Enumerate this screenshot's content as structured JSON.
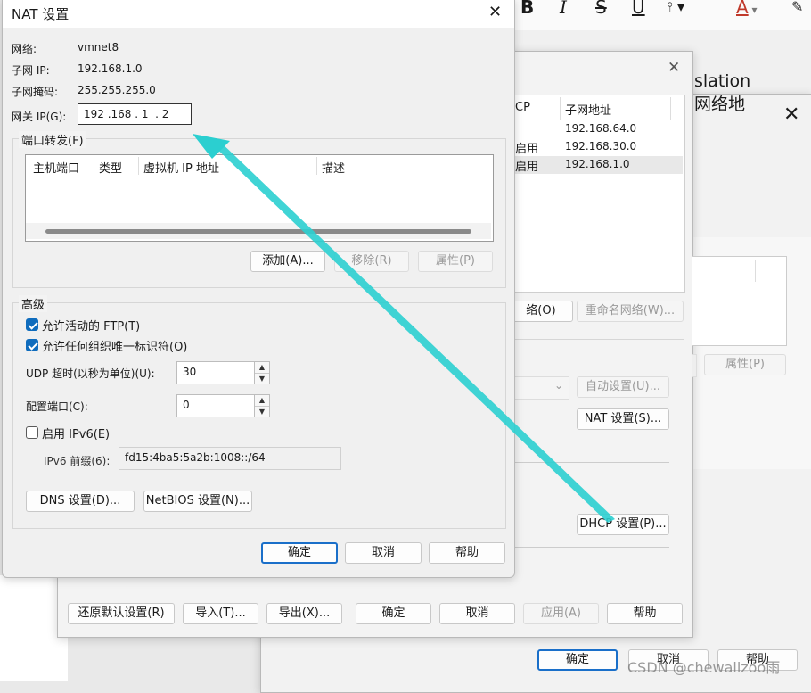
{
  "colors": {
    "accent": "#1a6fc9",
    "arrow": "#2bcfd0",
    "checked": "#0f6cbd"
  },
  "editor_toolbar": {
    "icons": [
      "bold-icon",
      "italic-icon",
      "strikethrough-icon",
      "underline-icon",
      "text-style-icon",
      "font-color-icon",
      "highlight-icon"
    ],
    "bold": "B",
    "italic": "I",
    "strike": "S",
    "underline": "U",
    "color": "A"
  },
  "bg_window": {
    "title_fragment": "slation 网络地",
    "table_headers": [
      "CP",
      "子网地址"
    ],
    "rows": [
      {
        "dhcp": "",
        "subnet": "192.168.64.0"
      },
      {
        "dhcp": "启用",
        "subnet": "192.168.30.0"
      },
      {
        "dhcp": "启用",
        "subnet": "192.168.1.0"
      }
    ],
    "network_btn": "络(O)",
    "rename_btn": "重命名网络(W)...",
    "properties_btn": "属性(P)",
    "auto_btn": "自动设置(U)...",
    "nat_btn": "NAT 设置(S)...",
    "dhcp_btn": "DHCP 设置(P)...",
    "restore_btn": "还原默认设置(R)",
    "import_btn": "导入(T)...",
    "export_btn": "导出(X)...",
    "ok_btn": "确定",
    "cancel_btn": "取消",
    "apply_btn": "应用(A)",
    "help_btn": "帮助",
    "far_ok": "确定",
    "far_cancel": "取消",
    "far_help": "帮助"
  },
  "watermark": "CSDN @chewallzoo雨",
  "nat": {
    "title": "NAT 设置",
    "network_label": "网络:",
    "network_value": "vmnet8",
    "subnet_ip_label": "子网 IP:",
    "subnet_ip_value": "192.168.1.0",
    "mask_label": "子网掩码:",
    "mask_value": "255.255.255.0",
    "gateway_label": "网关 IP(G):",
    "gateway_value": "192 .168 . 1  . 2",
    "port_forward_legend": "端口转发(F)",
    "pf_columns": [
      "主机端口",
      "类型",
      "虚拟机 IP 地址",
      "描述"
    ],
    "add_btn": "添加(A)...",
    "remove_btn": "移除(R)",
    "props_btn": "属性(P)",
    "advanced_legend": "高级",
    "ftp_label": "允许活动的 FTP(T)",
    "ftp_checked": true,
    "oui_label": "允许任何组织唯一标识符(O)",
    "oui_checked": true,
    "udp_label": "UDP 超时(以秒为单位)(U):",
    "udp_value": "30",
    "config_port_label": "配置端口(C):",
    "config_port_value": "0",
    "ipv6_label": "启用 IPv6(E)",
    "ipv6_checked": false,
    "ipv6_prefix_label": "IPv6 前缀(6):",
    "ipv6_prefix_value": "fd15:4ba5:5a2b:1008::/64",
    "dns_btn": "DNS 设置(D)...",
    "netbios_btn": "NetBIOS 设置(N)...",
    "ok_btn": "确定",
    "cancel_btn": "取消",
    "help_btn": "帮助"
  }
}
